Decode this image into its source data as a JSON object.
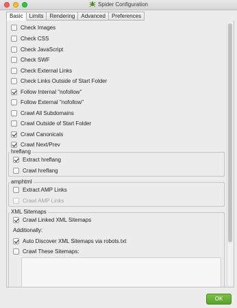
{
  "window": {
    "title": "Spider Configuration",
    "icon": "spider-icon"
  },
  "tabs": [
    {
      "label": "Basic",
      "active": true
    },
    {
      "label": "Limits",
      "active": false
    },
    {
      "label": "Rendering",
      "active": false
    },
    {
      "label": "Advanced",
      "active": false
    },
    {
      "label": "Preferences",
      "active": false
    }
  ],
  "options": [
    {
      "label": "Check Images",
      "checked": false
    },
    {
      "label": "Check CSS",
      "checked": false
    },
    {
      "label": "Check JavaScript",
      "checked": false
    },
    {
      "label": "Check SWF",
      "checked": false
    },
    {
      "label": "Check External Links",
      "checked": false
    },
    {
      "label": "Check Links Outside of Start Folder",
      "checked": false
    },
    {
      "label": "Follow Internal \"nofollow\"",
      "checked": true
    },
    {
      "label": "Follow External \"nofollow\"",
      "checked": false
    },
    {
      "label": "Crawl All Subdomains",
      "checked": false
    },
    {
      "label": "Crawl Outside of Start Folder",
      "checked": false
    },
    {
      "label": "Crawl Canonicals",
      "checked": true
    },
    {
      "label": "Crawl Next/Prev",
      "checked": true
    }
  ],
  "hreflang": {
    "title": "hreflang",
    "items": [
      {
        "label": "Extract hreflang",
        "checked": true,
        "disabled": false
      },
      {
        "label": "Crawl hreflang",
        "checked": false,
        "disabled": false
      }
    ]
  },
  "amphtml": {
    "title": "amphtml",
    "items": [
      {
        "label": "Extract AMP Links",
        "checked": false,
        "disabled": false
      },
      {
        "label": "Crawl AMP Links",
        "checked": false,
        "disabled": true
      }
    ]
  },
  "xml_sitemaps": {
    "title": "XML Sitemaps",
    "crawl_linked": {
      "label": "Crawl Linked XML Sitemaps",
      "checked": true
    },
    "additionally": "Additionally:",
    "auto_discover": {
      "label": "Auto Discover XML Sitemaps via robots.txt",
      "checked": true
    },
    "crawl_these": {
      "label": "Crawl These Sitemaps:",
      "checked": false
    },
    "sitemaps_text": ""
  },
  "footer": {
    "ok_label": "OK",
    "ok_color": "#5ea630"
  },
  "colors": {
    "close": "#fc5f57",
    "minimize": "#fdbc2e",
    "maximize": "#2ac840"
  }
}
